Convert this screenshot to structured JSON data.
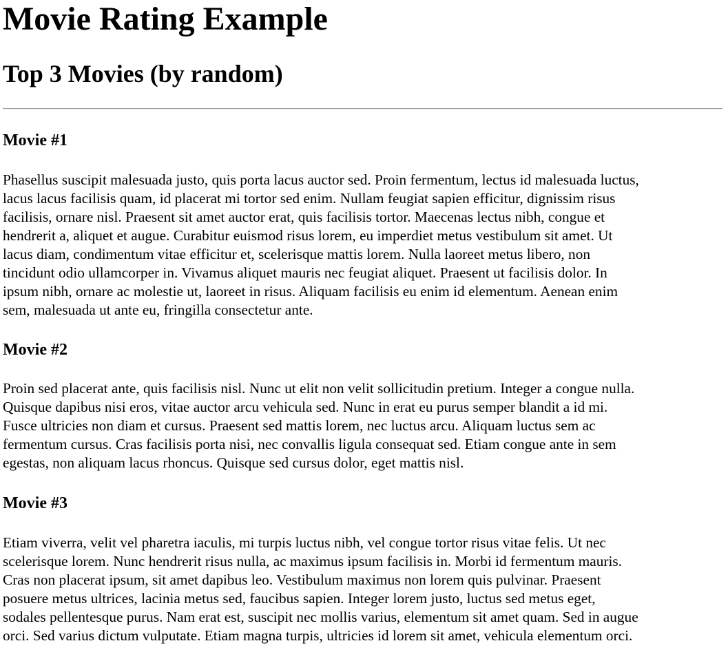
{
  "page": {
    "title": "Movie Rating Example",
    "subtitle": "Top 3 Movies (by random)"
  },
  "movies": [
    {
      "heading": "Movie #1",
      "lines": [
        "Phasellus suscipit malesuada justo, quis porta lacus auctor sed. Proin fermentum, lectus id malesuada luctus,",
        "lacus lacus facilisis quam, id placerat mi tortor sed enim. Nullam feugiat sapien efficitur, dignissim risus",
        "facilisis, ornare nisl. Praesent sit amet auctor erat, quis facilisis tortor. Maecenas lectus nibh, congue et",
        "hendrerit a, aliquet et augue. Curabitur euismod risus lorem, eu imperdiet metus vestibulum sit amet. Ut",
        "lacus diam, condimentum vitae efficitur et, scelerisque mattis lorem. Nulla laoreet metus libero, non",
        "tincidunt odio ullamcorper in. Vivamus aliquet mauris nec feugiat aliquet. Praesent ut facilisis dolor. In",
        "ipsum nibh, ornare ac molestie ut, laoreet in risus. Aliquam facilisis eu enim id elementum. Aenean enim",
        "sem, malesuada ut ante eu, fringilla consectetur ante."
      ]
    },
    {
      "heading": "Movie #2",
      "lines": [
        "Proin sed placerat ante, quis facilisis nisl. Nunc ut elit non velit sollicitudin pretium. Integer a congue nulla.",
        "Quisque dapibus nisi eros, vitae auctor arcu vehicula sed. Nunc in erat eu purus semper blandit a id mi.",
        "Fusce ultricies non diam et cursus. Praesent sed mattis lorem, nec luctus arcu. Aliquam luctus sem ac",
        "fermentum cursus. Cras facilisis porta nisi, nec convallis ligula consequat sed. Etiam congue ante in sem",
        "egestas, non aliquam lacus rhoncus. Quisque sed cursus dolor, eget mattis nisl."
      ]
    },
    {
      "heading": "Movie #3",
      "lines": [
        "Etiam viverra, velit vel pharetra iaculis, mi turpis luctus nibh, vel congue tortor risus vitae felis. Ut nec",
        "scelerisque lorem. Nunc hendrerit risus nulla, ac maximus ipsum facilisis in. Morbi id fermentum mauris.",
        "Cras non placerat ipsum, sit amet dapibus leo. Vestibulum maximus non lorem quis pulvinar. Praesent",
        "posuere metus ultrices, lacinia metus sed, faucibus sapien. Integer lorem justo, luctus sed metus eget,",
        "sodales pellentesque purus. Nam erat est, suscipit nec mollis varius, elementum sit amet quam. Sed in augue",
        "orci. Sed varius dictum vulputate. Etiam magna turpis, ultricies id lorem sit amet, vehicula elementum orci."
      ]
    }
  ]
}
